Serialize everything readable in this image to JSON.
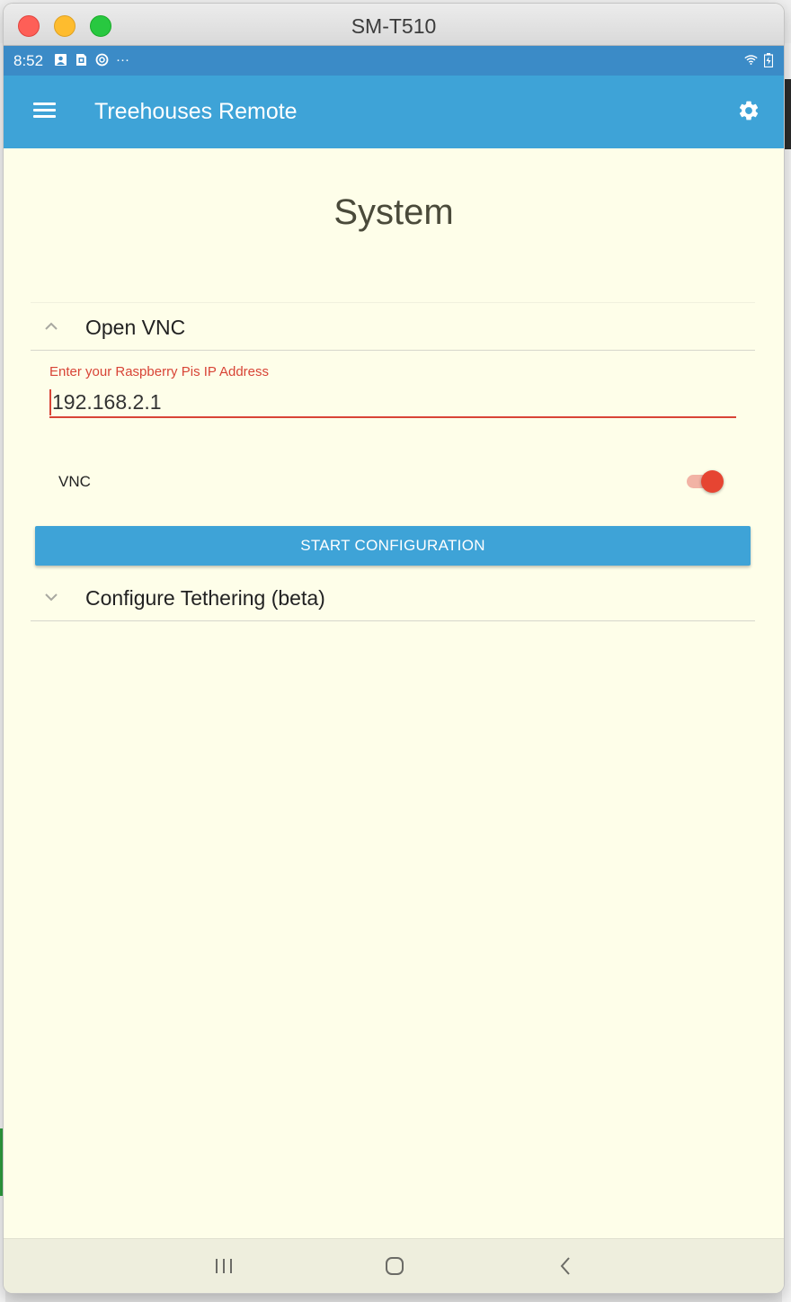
{
  "window": {
    "title": "SM-T510"
  },
  "status_bar": {
    "time": "8:52",
    "icons": [
      "notification-icon",
      "sim-icon",
      "sync-icon",
      "more-dots-icon"
    ],
    "right_icons": [
      "wifi-icon",
      "battery-icon"
    ],
    "more": "···"
  },
  "app_bar": {
    "title": "Treehouses Remote",
    "menu_icon": "hamburger-menu-icon",
    "settings_icon": "gear-icon"
  },
  "page": {
    "title": "System"
  },
  "sections": [
    {
      "label": "Open VNC",
      "expanded": true,
      "ip_label": "Enter your Raspberry Pis IP Address",
      "ip_value": "192.168.2.1",
      "vnc_label": "VNC",
      "vnc_enabled": true,
      "button_label": "START CONFIGURATION"
    },
    {
      "label": "Configure Tethering (beta)",
      "expanded": false
    }
  ],
  "colors": {
    "accent": "#3ea3d7",
    "status_bar": "#3b8bc7",
    "error": "#d84436",
    "background": "#fefee9"
  },
  "nav_bar": {
    "icons": [
      "recent-apps-icon",
      "home-icon",
      "back-icon"
    ]
  }
}
